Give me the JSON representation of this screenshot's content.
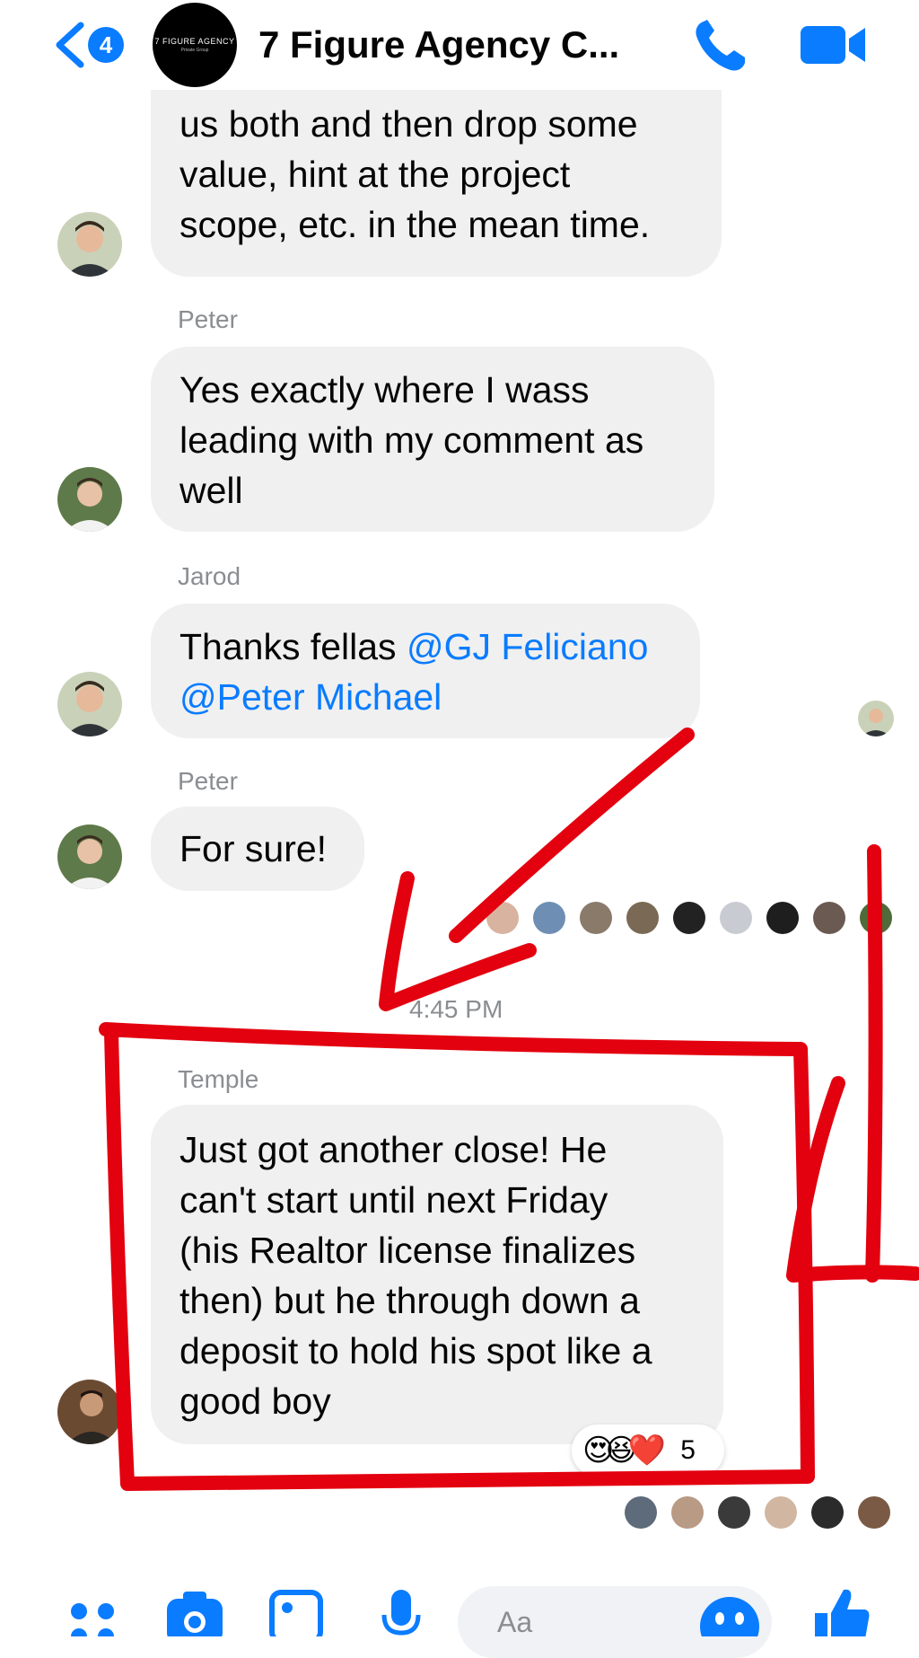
{
  "header": {
    "unread_count": "4",
    "title": "7 Figure Agency C...",
    "group_logo_text": "7 FIGURE AGENCY",
    "group_logo_sub": "Private Group",
    "icons": {
      "back": "chevron-left-icon",
      "phone": "phone-icon",
      "video": "video-camera-icon"
    }
  },
  "messages": [
    {
      "sender": "",
      "lines": [
        "us both and then drop some",
        "value, hint at the project",
        "scope, etc. in the mean time."
      ]
    },
    {
      "sender": "Peter",
      "lines": [
        "Yes exactly  where I wass",
        "leading with my comment as",
        "well"
      ]
    },
    {
      "sender": "Jarod",
      "lines_plain": "Thanks fellas ",
      "mention_1": "@GJ Feliciano",
      "mention_2": "@Peter Michael"
    },
    {
      "sender": "Peter",
      "lines": [
        "For sure!"
      ]
    },
    {
      "timestamp": "4:45 PM",
      "sender": "Temple",
      "lines": [
        "Just got another close! He",
        "can't start until next Friday",
        "(his Realtor license finalizes",
        "then) but he through down a",
        "deposit to hold his spot like a",
        "good boy"
      ],
      "reactions": {
        "emojis": [
          "😍",
          "😆",
          "❤️"
        ],
        "count": "5"
      }
    }
  ],
  "composer": {
    "placeholder": "Aa",
    "icons": [
      "apps-icon",
      "camera-icon",
      "gallery-icon",
      "microphone-icon",
      "emoji-icon",
      "thumbs-up-icon"
    ]
  },
  "annotation_color": "#e3000f",
  "accent": "#0a7cff"
}
